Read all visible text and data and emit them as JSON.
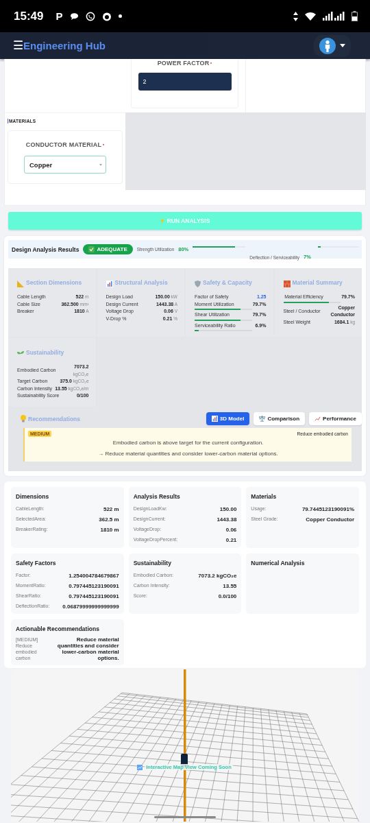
{
  "status_bar": {
    "time": "15:49",
    "app_letter": "P"
  },
  "app_bar": {
    "menu_icon": "☰",
    "title": "Engineering Hub"
  },
  "form": {
    "power_factor": {
      "label": "POWER FACTOR",
      "required": true,
      "value": "2"
    },
    "section_label": "MATERIALS",
    "conductor_material": {
      "label": "CONDUCTOR MATERIAL",
      "required": true,
      "value": "Copper"
    }
  },
  "run_button": {
    "label": "RUN ANALYSIS"
  },
  "results": {
    "title": "Design Analysis Results",
    "badge": {
      "label": "ADEQUATE"
    },
    "meters": [
      {
        "label": "Strength Utilization",
        "reading": "80%",
        "level": 0.8
      },
      {
        "label": "Deflection / Serviceability",
        "reading": "7%",
        "level": 0.07
      }
    ],
    "cards": [
      {
        "title": "Section Dimensions",
        "rows": [
          {
            "label": "Cable Length",
            "value": "522",
            "unit": "m"
          },
          {
            "label": "Cable Size",
            "value": "362.500",
            "unit": "mm²"
          },
          {
            "label": "Breaker",
            "value": "1810",
            "unit": "A"
          }
        ]
      },
      {
        "title": "Structural Analysis",
        "rows": [
          {
            "label": "Design Load",
            "value": "150.00",
            "unit": "kW"
          },
          {
            "label": "Design Current",
            "value": "1443.38",
            "unit": "A"
          },
          {
            "label": "Voltage Drop",
            "value": "0.06",
            "unit": "V"
          },
          {
            "label": "V-Drop %",
            "value": "0.21",
            "unit": "%"
          }
        ]
      },
      {
        "title": "Safety & Capacity",
        "rows": [
          {
            "label": "Factor of Safety",
            "value": "1.25",
            "highlight": true
          },
          {
            "label": "Moment Utilization",
            "value": "79.7%",
            "level": 0.797
          },
          {
            "label": "Shear Utilization",
            "value": "79.7%",
            "level": 0.797
          },
          {
            "label": "Serviceability Ratio",
            "value": "6.9%",
            "level": 0.069
          }
        ]
      },
      {
        "title": "Material Summary",
        "rows": [
          {
            "label": "Material Efficiency",
            "value": "79.7%",
            "level": 0.797
          },
          {
            "label": "Steel / Conductor",
            "value": "Copper Conductor"
          },
          {
            "label": "Steel Weight",
            "value": "1684.1",
            "unit": "kg"
          }
        ]
      },
      {
        "title": "Sustainability",
        "rows": [
          {
            "label": "Embodied Carbon",
            "value": "7073.2",
            "unit": "kgCO₂e"
          },
          {
            "label": "Target Carbon",
            "value": "375.0",
            "unit": "kgCO₂e"
          },
          {
            "label": "Carbon Intensity",
            "value": "13.55",
            "unit": "kgCO₂e/m"
          },
          {
            "label": "Sustainability Score",
            "value": "0/100"
          }
        ]
      }
    ]
  },
  "recommendations": {
    "title": "Recommendations",
    "tabs": [
      {
        "label": "3D Model",
        "selected": true
      },
      {
        "label": "Comparison",
        "selected": false
      },
      {
        "label": "Performance",
        "selected": false
      }
    ],
    "alert": {
      "priority": "MEDIUM",
      "title": "Reduce embodied carbon",
      "message": "Embodied carbon is above target for the current configuration.",
      "action": "→ Reduce material quantities and consider lower-carbon material options."
    }
  },
  "summary": {
    "cards": [
      {
        "title": "Dimensions",
        "rows": [
          {
            "label": "CableLength:",
            "value": "522 m"
          },
          {
            "label": "SelectedArea:",
            "value": "362.5 m"
          },
          {
            "label": "BreakerRating:",
            "value": "1810 m"
          }
        ]
      },
      {
        "title": "Analysis Results",
        "rows": [
          {
            "label": "DesignLoadKw:",
            "value": "150.00"
          },
          {
            "label": "DesignCurrent:",
            "value": "1443.38"
          },
          {
            "label": "VoltageDrop:",
            "value": "0.06"
          },
          {
            "label": "VoltageDropPercent:",
            "value": "0.21"
          }
        ]
      },
      {
        "title": "Materials",
        "rows": [
          {
            "label": "Usage:",
            "value": "79.7445123190091%"
          },
          {
            "label": "Steel Grade:",
            "value": "Copper Conductor"
          }
        ]
      },
      {
        "title": "Safety Factors",
        "rows": [
          {
            "label": "Factor:",
            "value": "1.254004784679867"
          },
          {
            "label": "MomentRatio:",
            "value": "0.797445123190091"
          },
          {
            "label": "ShearRatio:",
            "value": "0.797445123190091"
          },
          {
            "label": "DeflectionRatio:",
            "value": "0.06879999999999999"
          }
        ]
      },
      {
        "title": "Sustainability",
        "rows": [
          {
            "label": "Embodied Carbon:",
            "value": "7073.2 kgCO₂e"
          },
          {
            "label": "Carbon Intensity:",
            "value": "13.55"
          },
          {
            "label": "Score:",
            "value": "0.0/100"
          }
        ]
      },
      {
        "title": "Numerical Analysis"
      },
      {
        "title": "Actionable Recommendations",
        "rows": [
          {
            "label": "[MEDIUM] Reduce embodied carbon",
            "value": "Reduce material quantities and consider lower-carbon material options."
          }
        ]
      }
    ]
  },
  "model_view": {
    "overlay_text": "Interactive Map View Coming Soon"
  }
}
